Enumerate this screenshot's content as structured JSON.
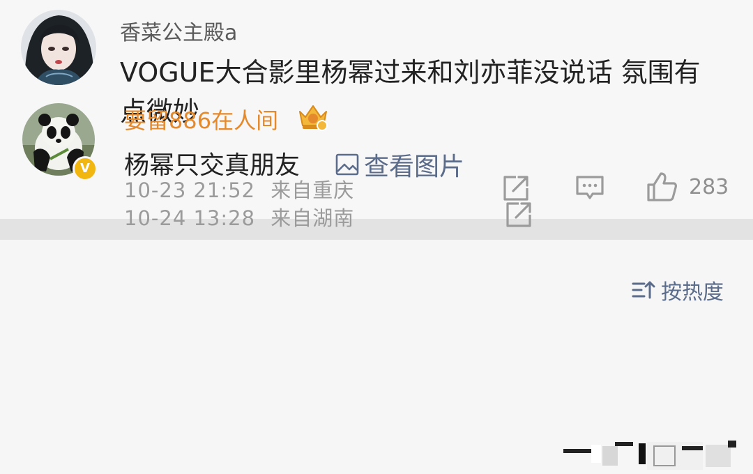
{
  "post": {
    "username": "香菜公主殿a",
    "content": "VOGUE大合影里杨幂过来和刘亦菲没说话 氛围有点微妙",
    "date": "10-23 21:52",
    "location": "来自重庆",
    "like_count": "283",
    "icons": {
      "share": "share-icon",
      "comment": "comment-icon",
      "like": "thumbs-up-icon"
    }
  },
  "sort": {
    "label": "按热度",
    "icon": "sort-icon"
  },
  "comment": {
    "username": "要留886在人间",
    "badge": "V",
    "text": "杨幂只交真朋友",
    "view_image_label": "查看图片",
    "date": "10-24 13:28",
    "location": "来自湖南",
    "icons": {
      "image": "image-icon",
      "crown": "crown-badge-icon",
      "share": "share-icon"
    }
  },
  "colors": {
    "background": "#f6f6f6",
    "divider": "#e3e3e3",
    "username_vip": "#e58a2c",
    "link": "#5b6b8a",
    "meta": "#9b9b9b"
  }
}
